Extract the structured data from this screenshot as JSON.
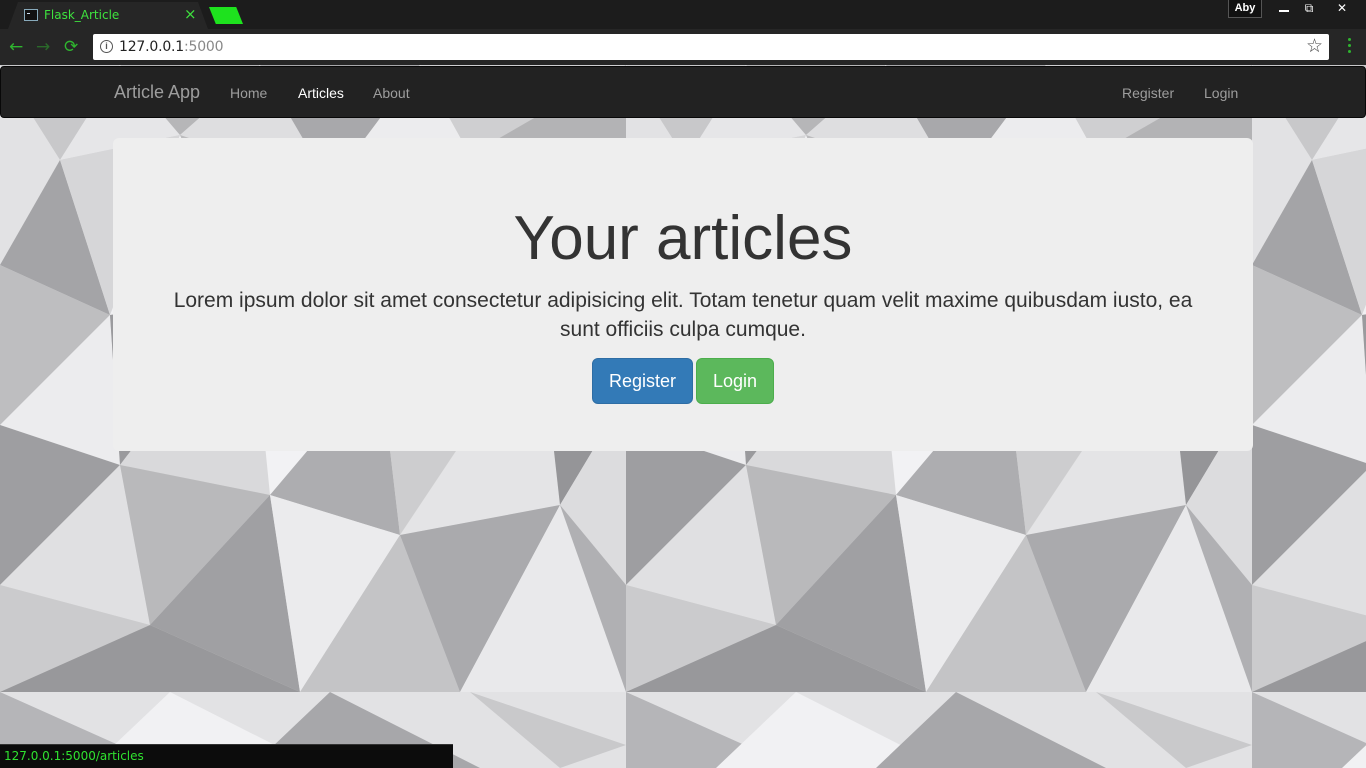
{
  "browser": {
    "tab_title": "Flask_Article",
    "tab_close": "×",
    "profile_name": "Aby",
    "window_controls": {
      "restore": "⧉",
      "close": "✕"
    },
    "url_host": "127.0.0.1",
    "url_port": ":5000",
    "back_icon": "←",
    "forward_icon": "→",
    "reload_icon": "⟳",
    "info_icon": "i",
    "bookmark_icon": "☆",
    "status_url": "127.0.0.1:5000/articles",
    "accent_color": "#2fb52f"
  },
  "navbar": {
    "brand": "Article App",
    "left_links": [
      {
        "label": "Home",
        "active": false
      },
      {
        "label": "Articles",
        "active": true
      },
      {
        "label": "About",
        "active": false
      }
    ],
    "right_links": [
      {
        "label": "Register"
      },
      {
        "label": "Login"
      }
    ]
  },
  "jumbotron": {
    "title": "Your articles",
    "text": "Lorem ipsum dolor sit amet consectetur adipisicing elit. Totam tenetur quam velit maxime quibusdam iusto, ea sunt officiis culpa cumque.",
    "register_button": "Register",
    "login_button": "Login",
    "primary_color": "#337ab7",
    "success_color": "#5cb85c"
  }
}
